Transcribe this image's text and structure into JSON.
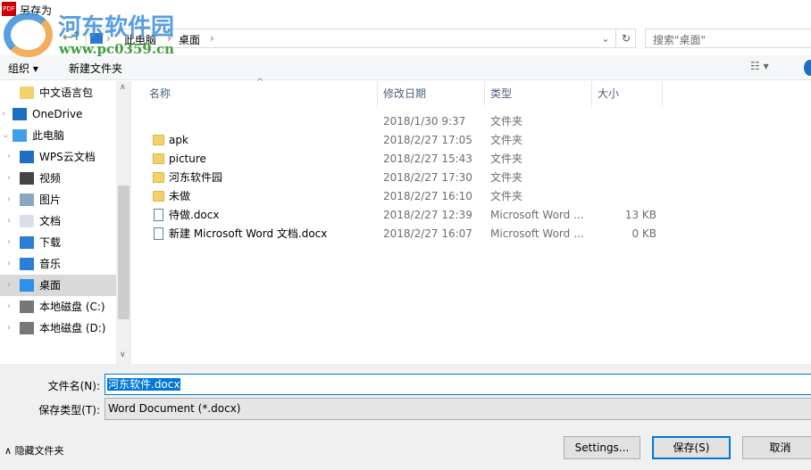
{
  "window": {
    "title": "另存为",
    "icon_text": "PDF"
  },
  "watermark": {
    "name": "河东软件园",
    "url": "www.pc0359.cn"
  },
  "address": {
    "crumbs": [
      "此电脑",
      "桌面"
    ],
    "search_placeholder": "搜索\"桌面\""
  },
  "toolbar": {
    "organize": "组织 ▾",
    "new_folder": "新建文件夹"
  },
  "nav": [
    {
      "label": "中文语言包",
      "icon": "folder-icon",
      "indent": 1
    },
    {
      "label": "OneDrive",
      "icon": "cloud-icon",
      "indent": 0
    },
    {
      "label": "此电脑",
      "icon": "computer-icon",
      "indent": 0
    },
    {
      "label": "WPS云文档",
      "icon": "cloud-icon",
      "indent": 1
    },
    {
      "label": "视频",
      "icon": "video-icon",
      "indent": 1
    },
    {
      "label": "图片",
      "icon": "picture-icon",
      "indent": 1
    },
    {
      "label": "文档",
      "icon": "document-icon",
      "indent": 1
    },
    {
      "label": "下载",
      "icon": "download-icon",
      "indent": 1
    },
    {
      "label": "音乐",
      "icon": "music-icon",
      "indent": 1
    },
    {
      "label": "桌面",
      "icon": "desktop-icon",
      "indent": 1,
      "selected": true
    },
    {
      "label": "本地磁盘 (C:)",
      "icon": "drive-icon",
      "indent": 1
    },
    {
      "label": "本地磁盘 (D:)",
      "icon": "drive-icon",
      "indent": 1
    }
  ],
  "columns": [
    "名称",
    "修改日期",
    "类型",
    "大小"
  ],
  "files": [
    {
      "name": "",
      "date": "2018/1/30 9:37",
      "type": "文件夹",
      "size": "",
      "kind": "none"
    },
    {
      "name": "apk",
      "date": "2018/2/27 17:05",
      "type": "文件夹",
      "size": "",
      "kind": "folder"
    },
    {
      "name": "picture",
      "date": "2018/2/27 15:43",
      "type": "文件夹",
      "size": "",
      "kind": "folder"
    },
    {
      "name": "河东软件园",
      "date": "2018/2/27 17:30",
      "type": "文件夹",
      "size": "",
      "kind": "folder"
    },
    {
      "name": "未做",
      "date": "2018/2/27 16:10",
      "type": "文件夹",
      "size": "",
      "kind": "folder"
    },
    {
      "name": "待做.docx",
      "date": "2018/2/27 12:39",
      "type": "Microsoft Word ...",
      "size": "13 KB",
      "kind": "doc"
    },
    {
      "name": "新建 Microsoft Word 文档.docx",
      "date": "2018/2/27 16:07",
      "type": "Microsoft Word ...",
      "size": "0 KB",
      "kind": "doc"
    }
  ],
  "form": {
    "filename_label": "文件名(N):",
    "filename": "河东软件.docx",
    "type_label": "保存类型(T):",
    "type": "Word Document (*.docx)"
  },
  "footer": {
    "hide_folders": "隐藏文件夹",
    "settings": "Settings...",
    "save": "保存(S)",
    "cancel": "取消"
  }
}
